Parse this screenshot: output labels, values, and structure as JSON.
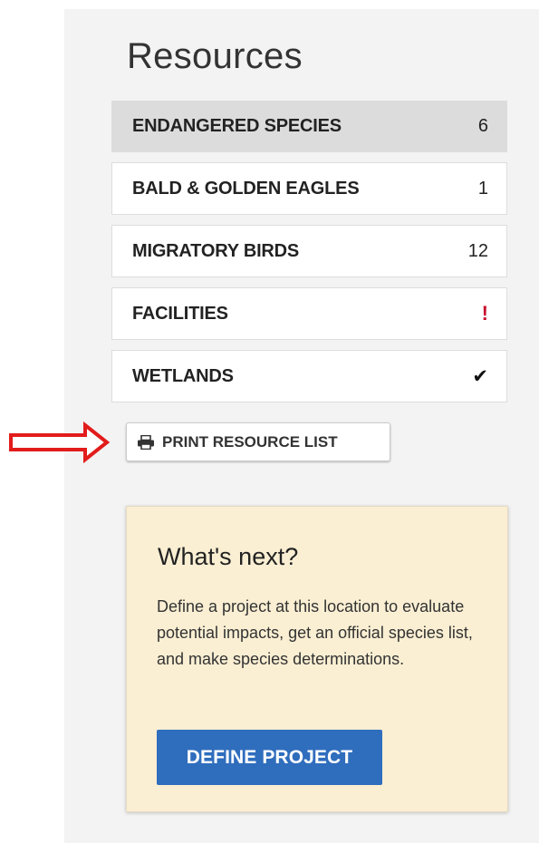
{
  "title": "Resources",
  "resources": [
    {
      "label": "ENDANGERED SPECIES",
      "count": "6"
    },
    {
      "label": "BALD & GOLDEN EAGLES",
      "count": "1"
    },
    {
      "label": "MIGRATORY BIRDS",
      "count": "12"
    },
    {
      "label": "FACILITIES",
      "count": "!"
    },
    {
      "label": "WETLANDS",
      "count": "✔"
    }
  ],
  "print_button": {
    "label": "PRINT RESOURCE LIST",
    "icon": "print-icon"
  },
  "annotation": {
    "icon": "arrow-right-icon",
    "color": "#e21b1b"
  },
  "next": {
    "title": "What's next?",
    "text": "Define a project at this location to evaluate potential impacts, get an official species list, and make species determinations.",
    "button": "DEFINE PROJECT"
  },
  "colors": {
    "accent": "#2f6dbd",
    "alert": "#c8102e",
    "card": "#faefd3",
    "active_row": "#dcdcdc"
  }
}
